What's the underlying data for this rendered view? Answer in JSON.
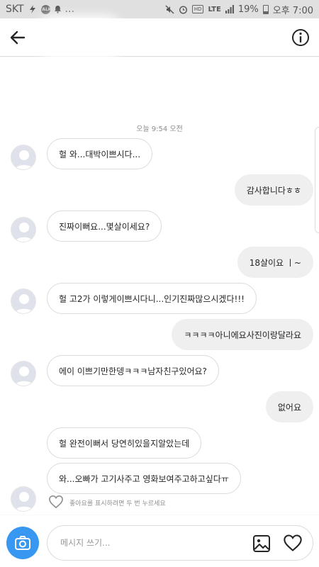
{
  "status_bar": {
    "carrier": "SKT",
    "talk_badge": "TALK",
    "more": "...",
    "hd_label": "HD",
    "lte": "LTE",
    "battery_pct": "19%",
    "time": "오후 7:00"
  },
  "header": {
    "title": ""
  },
  "chat": {
    "timestamp": "오늘 9:54 오전",
    "messages": [
      {
        "dir": "in",
        "text": "헐 와...대박이쁘시다..."
      },
      {
        "dir": "out",
        "text": "감사합니다ㅎㅎ"
      },
      {
        "dir": "in",
        "text": "진짜이뻐요...몇살이세요?"
      },
      {
        "dir": "out",
        "text": "18살이요 ㅣ~"
      },
      {
        "dir": "in",
        "text": "헐 고2가 이렇게이쁘시다니...인기진짜많으시겠다!!!"
      },
      {
        "dir": "out",
        "text": "ㅋㅋㅋㅋ아니에요사진이랑달라요"
      },
      {
        "dir": "in",
        "text": "에이 이쁘기만한뎅ㅋㅋㅋ남자친구있어요?"
      },
      {
        "dir": "out",
        "text": "없어요"
      },
      {
        "dir": "in",
        "text": "헐 완전이뻐서 당연히있을지알았는데"
      },
      {
        "dir": "in",
        "text": "와...오빠가 고기사주고 영화보여주고하고싶다ㅠ"
      }
    ],
    "like_hint": "좋아요를 표시하려면 두 번 누르세요"
  },
  "composer": {
    "placeholder": "메시지 쓰기..."
  },
  "icons": {
    "back": "back-arrow-icon",
    "info": "info-icon",
    "camera": "camera-icon",
    "gallery": "gallery-icon",
    "heart": "heart-icon",
    "avatar": "avatar-icon"
  },
  "colors": {
    "accent": "#3897f0",
    "incoming_border": "#dbdbdb",
    "outgoing_bg": "#efefef"
  }
}
